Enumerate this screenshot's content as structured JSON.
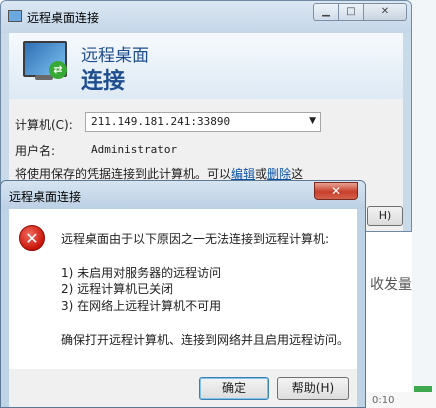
{
  "background": {
    "side_text": "收发量",
    "time_label": "0:10"
  },
  "rdc_window": {
    "title": "远程桌面连接",
    "header_line1": "远程桌面",
    "header_line2": "连接",
    "computer_label": "计算机(C):",
    "computer_value": "211.149.181.241:33890",
    "username_label": "用户名:",
    "username_value": "Administrator",
    "note_prefix": "将使用保存的凭据连接到此计算机。可以",
    "note_edit_link": "编辑",
    "note_or": "或",
    "note_delete_link": "删除",
    "note_suffix": "这",
    "partial_button": "H)"
  },
  "error_dialog": {
    "title": "远程桌面连接",
    "message_title": "远程桌面由于以下原因之一无法连接到远程计算机:",
    "reasons": [
      "1) 未启用对服务器的远程访问",
      "2) 远程计算机已关闭",
      "3) 在网络上远程计算机不可用"
    ],
    "advice": "确保打开远程计算机、连接到网络并且启用远程访问。",
    "ok_button": "确定",
    "help_button": "帮助(H)"
  },
  "icons": {
    "window_icon": "remote-desktop-icon",
    "error_icon": "error-x-icon",
    "combo_arrow": "chevron-down-icon"
  }
}
